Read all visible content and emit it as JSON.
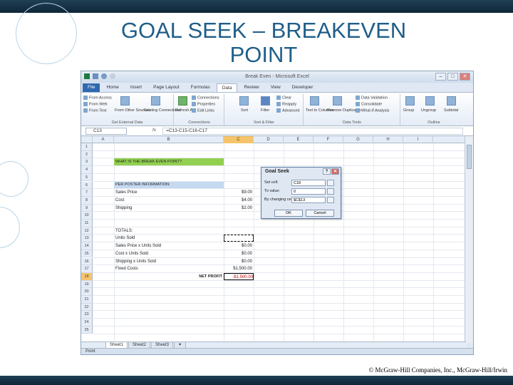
{
  "slide": {
    "title_line1": "GOAL SEEK – BREAKEVEN",
    "title_line2": "POINT",
    "copyright": "© McGraw-Hill Companies, Inc., McGraw-Hill/Irwin"
  },
  "excel": {
    "window_title": "Break Even - Microsoft Excel",
    "tabs": [
      "File",
      "Home",
      "Insert",
      "Page Layout",
      "Formulas",
      "Data",
      "Review",
      "View",
      "Developer"
    ],
    "active_tab": "Data",
    "ribbon": {
      "get_external": {
        "items": [
          "From Access",
          "From Web",
          "From Text"
        ],
        "from_other": "From Other Sources",
        "existing": "Existing Connections",
        "label": "Get External Data"
      },
      "connections": {
        "refresh": "Refresh All",
        "items": [
          "Connections",
          "Properties",
          "Edit Links"
        ],
        "label": "Connections"
      },
      "sort_filter": {
        "sort": "Sort",
        "filter": "Filter",
        "items": [
          "Clear",
          "Reapply",
          "Advanced"
        ],
        "label": "Sort & Filter"
      },
      "data_tools": {
        "text_to_columns": "Text to Columns",
        "remove_dup": "Remove Duplicates",
        "items": [
          "Data Validation",
          "Consolidate",
          "What-If Analysis"
        ],
        "label": "Data Tools"
      },
      "outline": {
        "items": [
          "Group",
          "Ungroup",
          "Subtotal"
        ],
        "label": "Outline"
      }
    },
    "name_box": "C13",
    "formula": "=C13-C15-C16-C17",
    "columns": [
      "A",
      "B",
      "C",
      "D",
      "E",
      "F",
      "G",
      "H",
      "I"
    ],
    "rows": [
      "1",
      "2",
      "3",
      "4",
      "5",
      "6",
      "7",
      "8",
      "9",
      "10",
      "11",
      "12",
      "13",
      "14",
      "15",
      "16",
      "17",
      "18",
      "19",
      "20",
      "21",
      "22",
      "23",
      "24",
      "25"
    ],
    "cells": {
      "b3": "WHAT IS THE BREAK EVEN POINT?",
      "b6": "PER POSTER INFORMATION:",
      "b7": "Sales Price",
      "c7": "$9.00",
      "b8": "Cost",
      "c8": "$4.00",
      "b9": "Shipping",
      "c9": "$2.00",
      "b12": "TOTALS:",
      "b13": "Units Sold",
      "b14": "Sales Price x Units Sold",
      "c14": "$0.00",
      "b15": "Cost x Units Sold",
      "c15": "$0.00",
      "b16": "Shipping x Units Sold",
      "c16": "$0.00",
      "b17": "Fixed Costs",
      "c17": "$1,500.00",
      "b18": "NET PROFIT",
      "c18": "-$1,500.00"
    },
    "sheets": [
      "Sheet1",
      "Sheet2",
      "Sheet3"
    ],
    "status": "Point",
    "dialog": {
      "title": "Goal Seek",
      "set_cell_label": "Set cell:",
      "set_cell": "C18",
      "to_value_label": "To value:",
      "to_value": "0",
      "changing_label": "By changing cell:",
      "changing": "$C$13",
      "ok": "OK",
      "cancel": "Cancel"
    },
    "colors": {
      "green": "#92d050",
      "blue": "#c5d9f1",
      "selected_row": "#f5c46a"
    }
  }
}
